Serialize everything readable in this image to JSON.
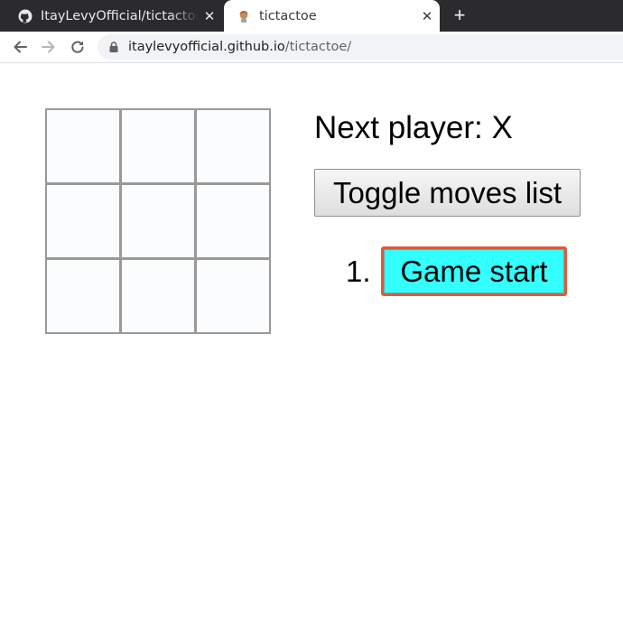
{
  "browser": {
    "tabs": [
      {
        "title": "ItayLevyOfficial/tictactoe",
        "favicon": "github-icon",
        "active": false
      },
      {
        "title": "tictactoe",
        "favicon": "react-avatar-icon",
        "active": true
      }
    ],
    "close_glyph": "✕",
    "new_tab_glyph": "+",
    "url_host": "itaylevyofficial.github.io",
    "url_path": "/tictactoe/"
  },
  "game": {
    "status": "Next player: X",
    "toggle_label": "Toggle moves list",
    "squares": [
      "",
      "",
      "",
      "",
      "",
      "",
      "",
      "",
      ""
    ],
    "moves": [
      {
        "number": "1.",
        "label": "Game start",
        "selected": true
      }
    ],
    "colors": {
      "board_border": "#999999",
      "selected_move_bg": "#33ffff",
      "selected_move_border": "#e05a38"
    }
  }
}
